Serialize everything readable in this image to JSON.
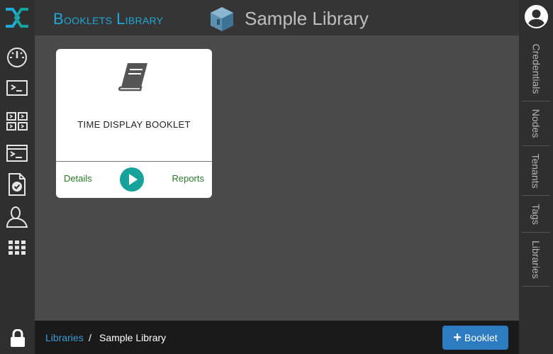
{
  "header": {
    "section_title_cap1": "B",
    "section_title_rest1": "ooklets ",
    "section_title_cap2": "L",
    "section_title_rest2": "ibrary",
    "library_name": "Sample Library"
  },
  "left_nav": {
    "icons": [
      "logo-icon",
      "dashboard-gauge-icon",
      "terminal-window-icon",
      "grid-terminals-icon",
      "console-icon",
      "checked-document-icon",
      "user-silhouette-icon",
      "apps-grid-icon",
      "lock-icon"
    ]
  },
  "right_nav": {
    "tabs": [
      "Credentials",
      "Nodes",
      "Tenants",
      "Tags",
      "Libraries"
    ]
  },
  "card": {
    "title": "TIME DISPLAY BOOKLET",
    "details_label": "Details",
    "reports_label": "Reports",
    "icon": "book-icon"
  },
  "footer": {
    "breadcrumb_link": "Libraries",
    "breadcrumb_sep": "/",
    "breadcrumb_current": "Sample Library",
    "add_button_label": "Booklet"
  },
  "colors": {
    "accent": "#1fa8d8",
    "play": "#15a39b",
    "button": "#2d7bc0",
    "link_green": "#2a7a2a"
  }
}
